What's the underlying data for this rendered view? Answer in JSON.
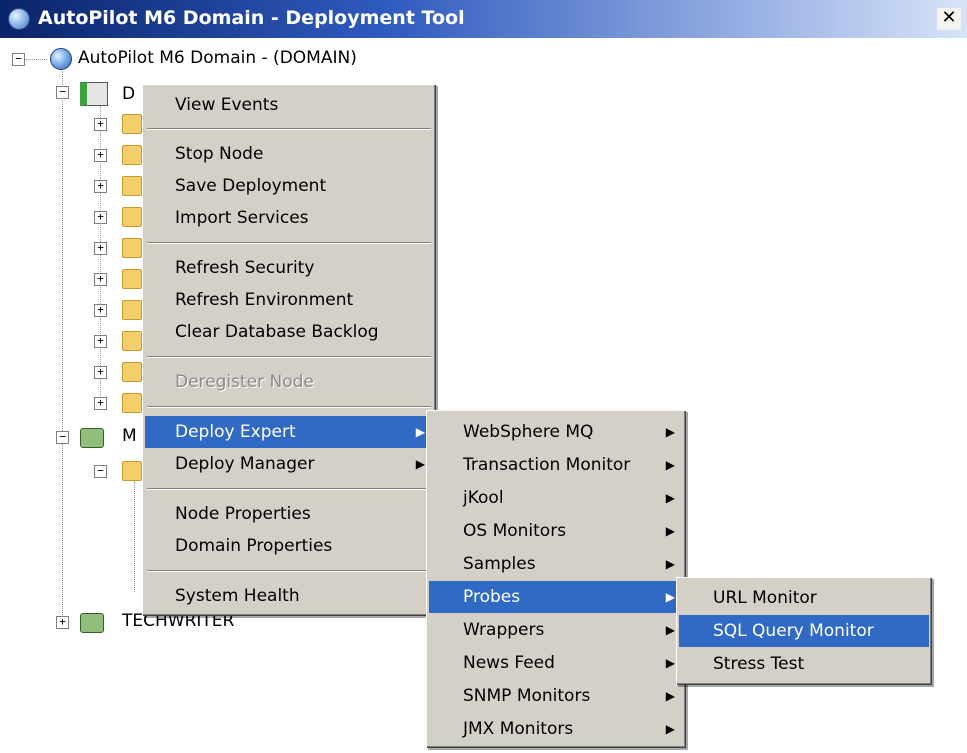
{
  "window": {
    "title": "AutoPilot M6 Domain - Deployment Tool",
    "close_glyph": "✕"
  },
  "tree": {
    "root_label": "AutoPilot M6 Domain - (DOMAIN)",
    "node1_label_partial": "D",
    "node2_label_partial": "M",
    "node3_label": "TECHWRITER"
  },
  "context_menu": {
    "items": [
      {
        "label": "View Events"
      },
      {
        "label": "Stop Node"
      },
      {
        "label": "Save Deployment"
      },
      {
        "label": "Import Services"
      },
      {
        "label": "Refresh Security"
      },
      {
        "label": "Refresh Environment"
      },
      {
        "label": "Clear Database Backlog"
      },
      {
        "label": "Deregister Node"
      },
      {
        "label": "Deploy Expert"
      },
      {
        "label": "Deploy Manager"
      },
      {
        "label": "Node Properties"
      },
      {
        "label": "Domain Properties"
      },
      {
        "label": "System Health"
      }
    ]
  },
  "expert_submenu": {
    "items": [
      {
        "label": "WebSphere MQ"
      },
      {
        "label": "Transaction Monitor"
      },
      {
        "label": "jKool"
      },
      {
        "label": "OS Monitors"
      },
      {
        "label": "Samples"
      },
      {
        "label": "Probes"
      },
      {
        "label": "Wrappers"
      },
      {
        "label": "News Feed"
      },
      {
        "label": "SNMP Monitors"
      },
      {
        "label": "JMX Monitors"
      }
    ]
  },
  "probes_submenu": {
    "items": [
      {
        "label": "URL Monitor"
      },
      {
        "label": "SQL Query Monitor"
      },
      {
        "label": "Stress Test"
      }
    ]
  },
  "colors": {
    "highlight": "#316ac5",
    "menu_bg": "#d4d0c8",
    "title_start": "#0a246a"
  },
  "glyphs": {
    "submenu_arrow": "▶",
    "expand": "+",
    "collapse": "−"
  }
}
